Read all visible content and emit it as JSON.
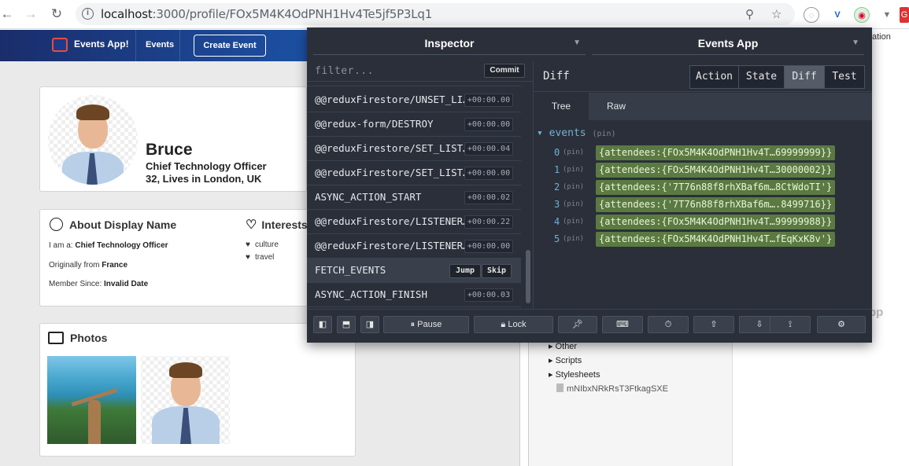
{
  "browser": {
    "url_host": "localhost",
    "url_path": ":3000/profile/FOx5M4K4OdPNH1Hv4Te5jf5P3Lq1"
  },
  "navbar": {
    "brand": "Events App!",
    "events_link": "Events",
    "create_button": "Create Event"
  },
  "profile": {
    "name": "Bruce",
    "role": "Chief Technology Officer",
    "location": "32, Lives in London, UK"
  },
  "about": {
    "title": "About Display Name",
    "iam_label": "I am a: ",
    "iam_value": "Chief Technology Officer",
    "origin_label": "Originally from ",
    "origin_value": "France",
    "member_label": "Member Since: ",
    "member_value": "Invalid Date"
  },
  "interests": {
    "title": "Interests",
    "items": [
      "culture",
      "travel"
    ]
  },
  "photos": {
    "title": "Photos"
  },
  "devtools_tree": {
    "other": "Other",
    "scripts": "Scripts",
    "stylesheets": "Stylesheets",
    "file": "mNIbxNRkRsT3FtkagSXE",
    "tab_fragment": "ation",
    "cut_text": "pp"
  },
  "redux": {
    "monitor": "Inspector",
    "instance": "Events App",
    "filter_placeholder": "filter...",
    "commit": "Commit",
    "actions": [
      {
        "name": "@@reduxFirestore/UNSET_LI…",
        "time": "+00:00.00"
      },
      {
        "name": "@@redux-form/DESTROY",
        "time": "+00:00.00"
      },
      {
        "name": "@@reduxFirestore/SET_LIST…",
        "time": "+00:00.04"
      },
      {
        "name": "@@reduxFirestore/SET_LIST…",
        "time": "+00:00.00"
      },
      {
        "name": "ASYNC_ACTION_START",
        "time": "+00:00.02"
      },
      {
        "name": "@@reduxFirestore/LISTENER…",
        "time": "+00:00.22"
      },
      {
        "name": "@@reduxFirestore/LISTENER…",
        "time": "+00:00.00"
      },
      {
        "name": "FETCH_EVENTS",
        "time": ""
      },
      {
        "name": "ASYNC_ACTION_FINISH",
        "time": "+00:00.03"
      }
    ],
    "jump": "Jump",
    "skip": "Skip",
    "panel_title": "Diff",
    "tabs": [
      "Action",
      "State",
      "Diff",
      "Test"
    ],
    "subtabs": [
      "Tree",
      "Raw"
    ],
    "root_key": "events",
    "pin": "(pin)",
    "entries": [
      {
        "index": "0",
        "value": "{attendees:{FOx5M4K4OdPNH1Hv4T…69999999}}"
      },
      {
        "index": "1",
        "value": "{attendees:{FOx5M4K4OdPNH1Hv4T…30000002}}"
      },
      {
        "index": "2",
        "value": "{attendees:{'7T76n88f8rhXBaf6m…8CtWdoTI'}"
      },
      {
        "index": "3",
        "value": "{attendees:{'7T76n88f8rhXBaf6m….8499716}}"
      },
      {
        "index": "4",
        "value": "{attendees:{FOx5M4K4OdPNH1Hv4T…99999988}}"
      },
      {
        "index": "5",
        "value": "{attendees:{FOx5M4K4OdPNH1Hv4T…fEqKxK8v'}"
      }
    ],
    "pause": "Pause",
    "lock": "Lock"
  }
}
